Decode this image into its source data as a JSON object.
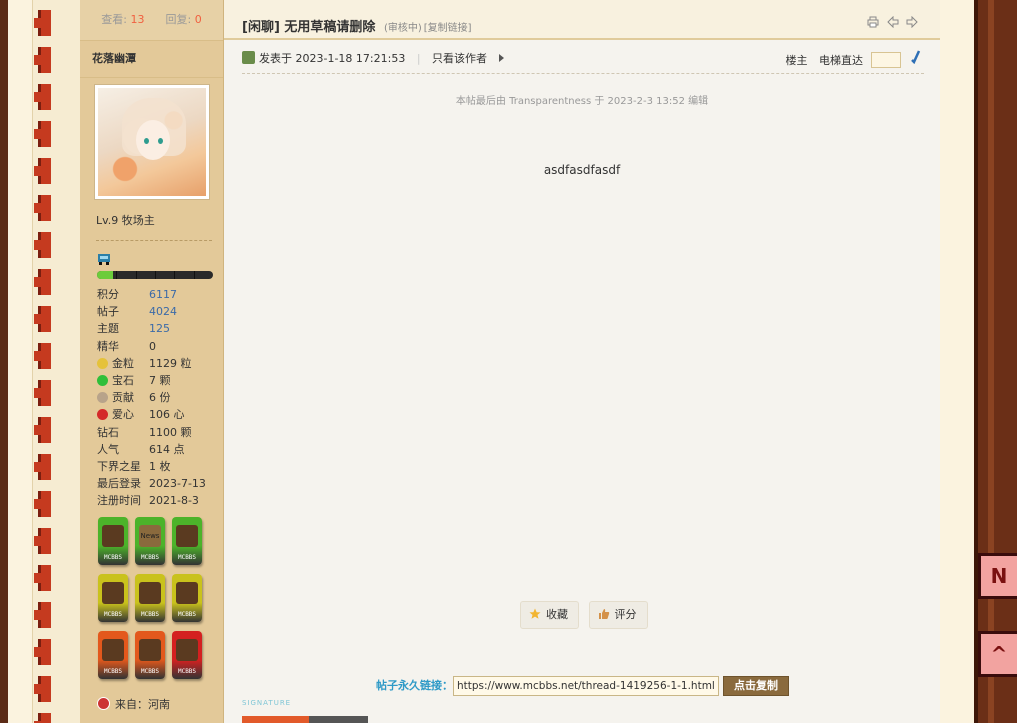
{
  "stats": {
    "views_label": "查看:",
    "views": "13",
    "replies_label": "回复:",
    "replies": "0"
  },
  "user": {
    "name": "花落幽潭",
    "level": "Lv.9 牧场主",
    "progress": 0.14,
    "profile": [
      {
        "label": "积分",
        "value": "6117",
        "link": true
      },
      {
        "label": "帖子",
        "value": "4024",
        "link": true
      },
      {
        "label": "主题",
        "value": "125",
        "link": true
      },
      {
        "label": "精华",
        "value": "0",
        "link": false
      },
      {
        "label": "金粒",
        "value": "1129 粒",
        "icon": "gold-nugget-icon",
        "color": "#e5c23a"
      },
      {
        "label": "宝石",
        "value": "7 颗",
        "icon": "emerald-icon",
        "color": "#2fbf3a"
      },
      {
        "label": "贡献",
        "value": "6 份",
        "icon": "contribution-icon",
        "color": "#b8a38a"
      },
      {
        "label": "爱心",
        "value": "106 心",
        "icon": "heart-apple-icon",
        "color": "#d42a2a"
      },
      {
        "label": "钻石",
        "value": "1100 颗",
        "link": false
      },
      {
        "label": "人气",
        "value": "614 点",
        "link": false
      },
      {
        "label": "下界之星",
        "value": "1 枚",
        "link": false
      },
      {
        "label": "最后登录",
        "value": "2023-7-13",
        "link": false
      },
      {
        "label": "注册时间",
        "value": "2021-8-3",
        "link": false
      }
    ],
    "medal_tag": "MCBBS",
    "medals": [
      {
        "name": "book-medal-icon",
        "color": "#4cb32a"
      },
      {
        "name": "news-medal-icon",
        "color": "#4cb32a",
        "text": "News"
      },
      {
        "name": "no-entry-medal-icon",
        "color": "#4cb32a"
      },
      {
        "name": "pickaxe-medal-icon",
        "color": "#c9c21c"
      },
      {
        "name": "pickaxe-medal-icon",
        "color": "#c9c21c"
      },
      {
        "name": "pickaxe-medal-icon",
        "color": "#c9c21c"
      },
      {
        "name": "sapling-medal-icon",
        "color": "#e3581c"
      },
      {
        "name": "bush-medal-icon",
        "color": "#e3581c"
      },
      {
        "name": "java-medal-icon",
        "color": "#d42020"
      }
    ],
    "from_label": "来自：",
    "from": "河南"
  },
  "thread": {
    "title": "[闲聊] 无用草稿请删除",
    "status": "(审核中)",
    "copy_link": "[复制链接]"
  },
  "post": {
    "posted_label": "发表于",
    "posted_at": "2023-1-18 17:21:53",
    "only_author": "只看该作者",
    "floor": "楼主",
    "jump_label": "电梯直达",
    "edit_note": "本帖最后由 Transparentness 于 2023-2-3 13:52 编辑",
    "body": "asdfasdfasdf",
    "favorite": "收藏",
    "rate": "评分",
    "permalink_label": "帖子永久链接：",
    "permalink": "https://www.mcbbs.net/thread-1419256-1-1.html",
    "copy_button": "点击复制",
    "signature_label": "SIGNATURE"
  },
  "colors": {
    "accent_orange": "#f06040",
    "link_blue": "#3a6aa8",
    "permalink_blue": "#2e9ac7"
  }
}
